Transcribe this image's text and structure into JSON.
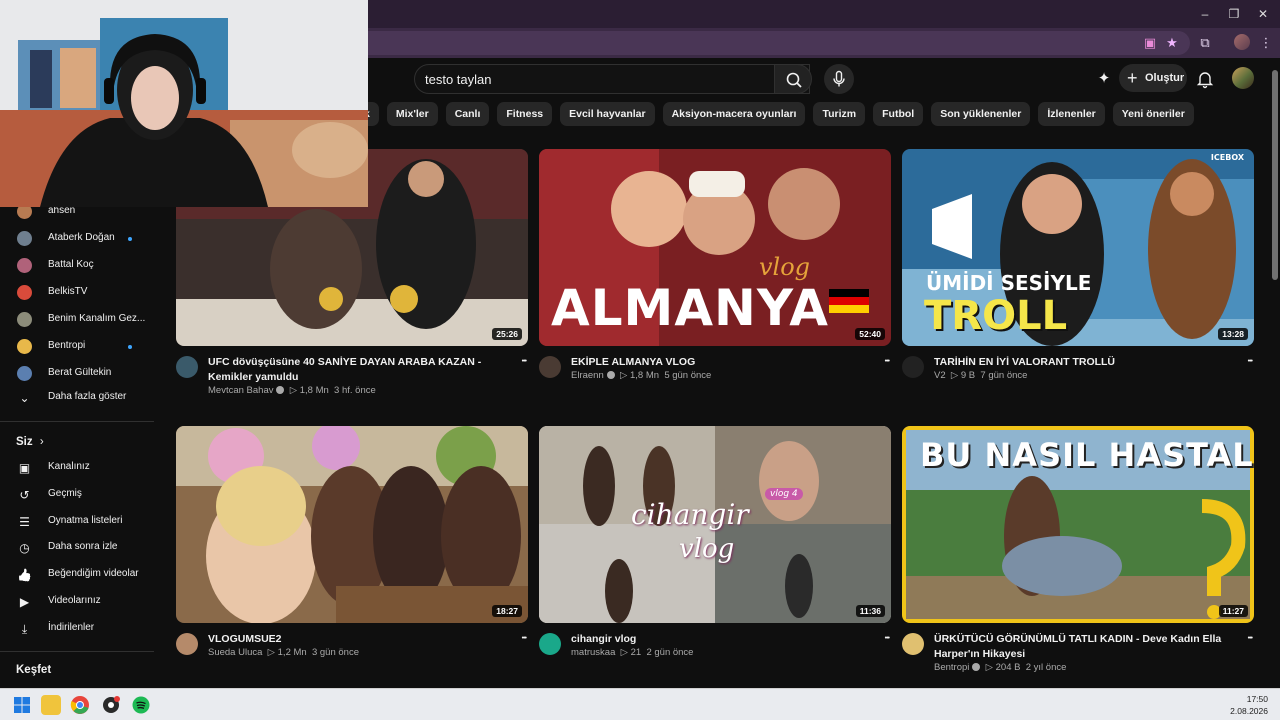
{
  "search": {
    "query": "testo taylan"
  },
  "header": {
    "create_label": "Oluştur"
  },
  "chips": [
    "k",
    "Mix'ler",
    "Canlı",
    "Fitness",
    "Evcil hayvanlar",
    "Aksiyon-macera oyunları",
    "Turizm",
    "Futbol",
    "Son yüklenenler",
    "İzlenenler",
    "Yeni öneriler"
  ],
  "sidebar": {
    "subscriptions": [
      {
        "name": "ahsen",
        "new": false,
        "color": "#b77b52"
      },
      {
        "name": "Ataberk Doğan",
        "new": true,
        "color": "#6f7f8f"
      },
      {
        "name": "Battal Koç",
        "new": false,
        "color": "#b0627a"
      },
      {
        "name": "BelkisTV",
        "new": false,
        "color": "#d94b3b"
      },
      {
        "name": "Benim Kanalım Gez...",
        "new": false,
        "color": "#8c8c7a"
      },
      {
        "name": "Bentropi",
        "new": true,
        "color": "#e8b84a"
      },
      {
        "name": "Berat Gültekin",
        "new": false,
        "color": "#5b7fb0"
      }
    ],
    "show_more": "Daha fazla göster",
    "you_section": "Siz",
    "you_items": [
      {
        "label": "Kanalınız",
        "icon": "channel-icon"
      },
      {
        "label": "Geçmiş",
        "icon": "history-icon"
      },
      {
        "label": "Oynatma listeleri",
        "icon": "playlist-icon"
      },
      {
        "label": "Daha sonra izle",
        "icon": "watch-later-icon"
      },
      {
        "label": "Beğendiğim videolar",
        "icon": "like-icon"
      },
      {
        "label": "Videolarınız",
        "icon": "your-videos-icon"
      },
      {
        "label": "İndirilenler",
        "icon": "download-icon"
      }
    ],
    "explore_section": "Keşfet"
  },
  "videos": [
    {
      "title": "UFC dövüşçüsüne 40 SANİYE DAYAN ARABA KAZAN - Kemikler yamuldu",
      "channel": "Mevtcan Bahav",
      "verified": true,
      "views": "1,8 Mn",
      "age": "3 hf. önce",
      "duration": "25:26"
    },
    {
      "title": "EKİPLE ALMANYA VLOG",
      "channel": "Elraenn",
      "verified": true,
      "views": "1,8 Mn",
      "age": "5 gün önce",
      "duration": "52:40",
      "thumb_text": "ALMANYA",
      "thumb_sub": "vlog"
    },
    {
      "title": "TARİHİN EN İYİ VALORANT TROLLÜ",
      "channel": "V2",
      "verified": false,
      "views": "9 B",
      "age": "7 gün önce",
      "duration": "13:28",
      "thumb_text": "TROLL",
      "thumb_sub": "ÜMİDİ SESİYLE",
      "thumb_corner": "ICEBOX"
    },
    {
      "title": "VLOGUMSUE2",
      "channel": "Sueda Uluca",
      "verified": false,
      "views": "1,2 Mn",
      "age": "3 gün önce",
      "duration": "18:27"
    },
    {
      "title": "cihangir vlog",
      "channel": "matruskaa",
      "verified": false,
      "views": "21",
      "age": "2 gün önce",
      "duration": "11:36",
      "thumb_text": "cihangir",
      "thumb_sub": "vlog",
      "thumb_corner": "vlog 4"
    },
    {
      "title": "ÜRKÜTÜCÜ GÖRÜNÜMLÜ TATLI KADIN - Deve Kadın Ella Harper'ın Hikayesi",
      "channel": "Bentropi",
      "verified": true,
      "views": "204 B",
      "age": "2 yıl önce",
      "duration": "11:27",
      "thumb_text": "BU NASIL HASTALIK"
    }
  ],
  "taskbar": {
    "time": "17:50",
    "date": "2.08.2026"
  },
  "colors": {
    "background": "#0f0f0f",
    "chip": "#272727",
    "accent_dot": "#3ea6ff",
    "chrome": "#3b2a45"
  }
}
